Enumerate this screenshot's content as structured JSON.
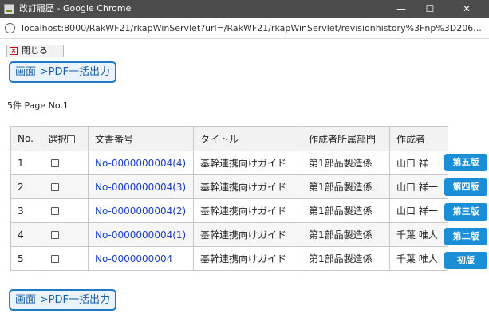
{
  "window": {
    "title": "改訂履歴 - Google Chrome",
    "minimize": "—",
    "maximize": "☐",
    "close": "✕"
  },
  "address": {
    "url": "localhost:8000/RakWF21/rkapWinServlet?url=/RakWF21/rkapWinServlet/revisionhistory%3Fnp%3D206..."
  },
  "toolbar": {
    "close_label": "閉じる",
    "pdf_label": "画面->PDF一括出力"
  },
  "summary": "5件 Page No.1",
  "table": {
    "headers": [
      "No.",
      "選択",
      "文書番号",
      "タイトル",
      "作成者所属部門",
      "作成者"
    ],
    "rows": [
      {
        "no": "1",
        "doc": "No-0000000004(4)",
        "title": "基幹連携向けガイド",
        "dept": "第1部品製造係",
        "author": "山口 祥一",
        "badge": "第五版"
      },
      {
        "no": "2",
        "doc": "No-0000000004(3)",
        "title": "基幹連携向けガイド",
        "dept": "第1部品製造係",
        "author": "山口 祥一",
        "badge": "第四版"
      },
      {
        "no": "3",
        "doc": "No-0000000004(2)",
        "title": "基幹連携向けガイド",
        "dept": "第1部品製造係",
        "author": "山口 祥一",
        "badge": "第三版"
      },
      {
        "no": "4",
        "doc": "No-0000000004(1)",
        "title": "基幹連携向けガイド",
        "dept": "第1部品製造係",
        "author": "千葉 唯人",
        "badge": "第二版"
      },
      {
        "no": "5",
        "doc": "No-0000000004",
        "title": "基幹連携向けガイド",
        "dept": "第1部品製造係",
        "author": "千葉 唯人",
        "badge": "初版"
      }
    ]
  }
}
